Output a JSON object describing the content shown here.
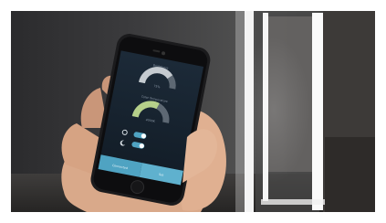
{
  "app": {
    "gauge_top": {
      "title": "Brightness",
      "value": "75%",
      "fill_fraction": 0.75
    },
    "gauge_bottom": {
      "title": "Color Temperature",
      "value": "4000K",
      "fill_fraction": 0.6
    },
    "toggles": [
      {
        "icon": "sun-icon",
        "state": "on"
      },
      {
        "icon": "moon-icon",
        "state": "on"
      }
    ],
    "buttons": [
      {
        "label": "Connected"
      },
      {
        "label": "Set"
      }
    ]
  },
  "colors": {
    "teal_accent": "#4fa3c2",
    "gauge_green": "#b6d08a",
    "gauge_grey": "#c5cbd0",
    "frame_light": "#f2f2f2"
  }
}
